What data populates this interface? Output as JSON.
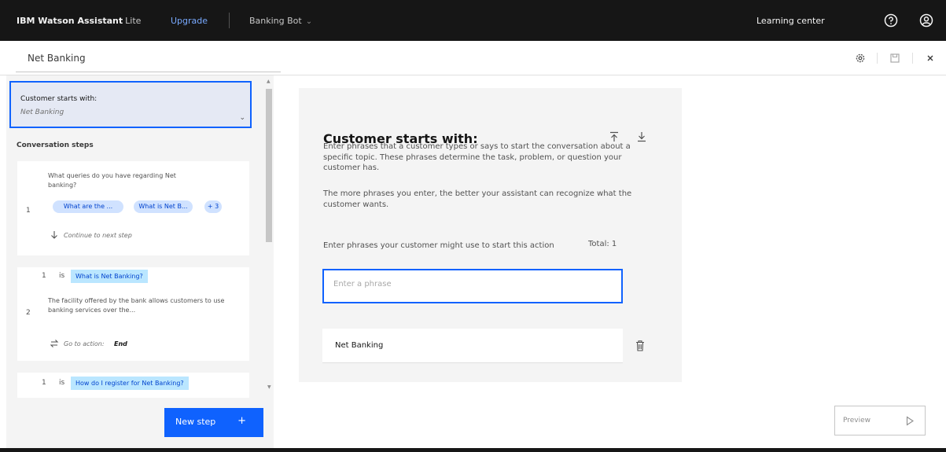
{
  "header": {
    "brand_name": "IBM Watson Assistant",
    "brand_tier": "Lite",
    "upgrade_label": "Upgrade",
    "assistant_name": "Banking Bot",
    "learning_center_label": "Learning center",
    "icons": [
      "help-icon",
      "user-icon",
      "chevron-down-icon"
    ]
  },
  "action": {
    "title": "Net Banking",
    "icons": [
      "settings-icon",
      "save-icon",
      "close-icon"
    ]
  },
  "sidebar": {
    "starts_with": {
      "label": "Customer starts with:",
      "value": "Net Banking"
    },
    "steps_heading": "Conversation steps",
    "steps": [
      {
        "number": "1",
        "text": "What queries do you have regarding Net banking?",
        "chips": [
          "What are the ...",
          "What is Net B...",
          "+ 3"
        ],
        "continue_label": "Continue to next step"
      },
      {
        "number": "2",
        "condition_index": "1",
        "condition_op": "is",
        "condition_value": "What is Net Banking?",
        "text": "The facility offered by the bank allows customers to use banking services over the...",
        "goto_prefix": "Go to action:",
        "goto_target": "End"
      },
      {
        "condition_index": "1",
        "condition_op": "is",
        "condition_value": "How do I register for Net Banking?"
      }
    ],
    "new_step_label": "New step",
    "new_step_plus": "+"
  },
  "editor": {
    "title": "Customer starts with:",
    "description_1": "Enter phrases that a customer types or says to start the conversation about a specific topic. These phrases determine the task, problem, or question your customer has.",
    "description_2": "The more phrases you enter, the better your assistant can recognize what the customer wants.",
    "phrases_label": "Enter phrases your customer might use to start this action",
    "total_label": "Total: 1",
    "input_placeholder": "Enter a phrase",
    "phrases": [
      "Net Banking"
    ],
    "icons": [
      "upload-icon",
      "download-icon",
      "trash-icon"
    ]
  },
  "footer": {
    "preview_label": "Preview"
  },
  "colors": {
    "topbar_bg": "#161616",
    "accent_blue": "#0f62fe",
    "chip_bg": "#d0e2ff",
    "condition_bg": "#bae6ff",
    "panel_bg": "#f4f4f4",
    "upgrade_link": "#78a9ff"
  }
}
